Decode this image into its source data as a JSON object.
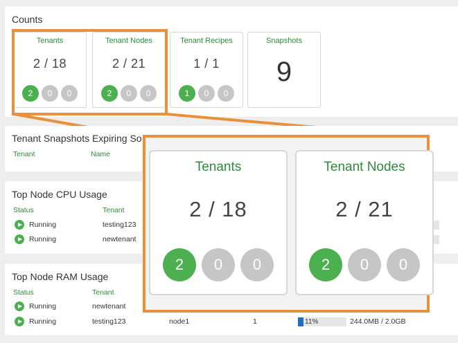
{
  "counts": {
    "title": "Counts",
    "cards": [
      {
        "title": "Tenants",
        "value": "2 / 18",
        "dots": [
          "2",
          "0",
          "0"
        ]
      },
      {
        "title": "Tenant Nodes",
        "value": "2 / 21",
        "dots": [
          "2",
          "0",
          "0"
        ]
      },
      {
        "title": "Tenant Recipes",
        "value": "1 / 1",
        "dots": [
          "1",
          "0",
          "0"
        ]
      },
      {
        "title": "Snapshots",
        "value": "9"
      }
    ]
  },
  "snapshots_panel": {
    "title": "Tenant Snapshots Expiring So",
    "columns": [
      "Tenant",
      "Name"
    ]
  },
  "cpu_panel": {
    "title": "Top Node CPU Usage",
    "columns": [
      "Status",
      "Tenant"
    ],
    "rows": [
      {
        "status": "Running",
        "tenant": "testing123"
      },
      {
        "status": "Running",
        "tenant": "newtenant"
      }
    ]
  },
  "ram_panel": {
    "title": "Top Node RAM Usage",
    "columns": [
      "Status",
      "Tenant"
    ],
    "rows": [
      {
        "status": "Running",
        "tenant": "newtenant"
      },
      {
        "status": "Running",
        "tenant": "testing123",
        "node": "node1",
        "count": "1",
        "usage_pct": 11,
        "usage_label": "11%",
        "usage_text": "244.0MB / 2.0GB"
      }
    ]
  },
  "zoom": {
    "cards": [
      {
        "title": "Tenants",
        "value": "2 / 18",
        "dots": [
          "2",
          "0",
          "0"
        ]
      },
      {
        "title": "Tenant Nodes",
        "value": "2 / 21",
        "dots": [
          "2",
          "0",
          "0"
        ]
      }
    ]
  },
  "colors": {
    "accent_green": "#4caf50",
    "highlight_orange": "#e8913a",
    "bar_blue": "#1e6fc0"
  },
  "icons": {
    "status": "play-circle-icon"
  }
}
